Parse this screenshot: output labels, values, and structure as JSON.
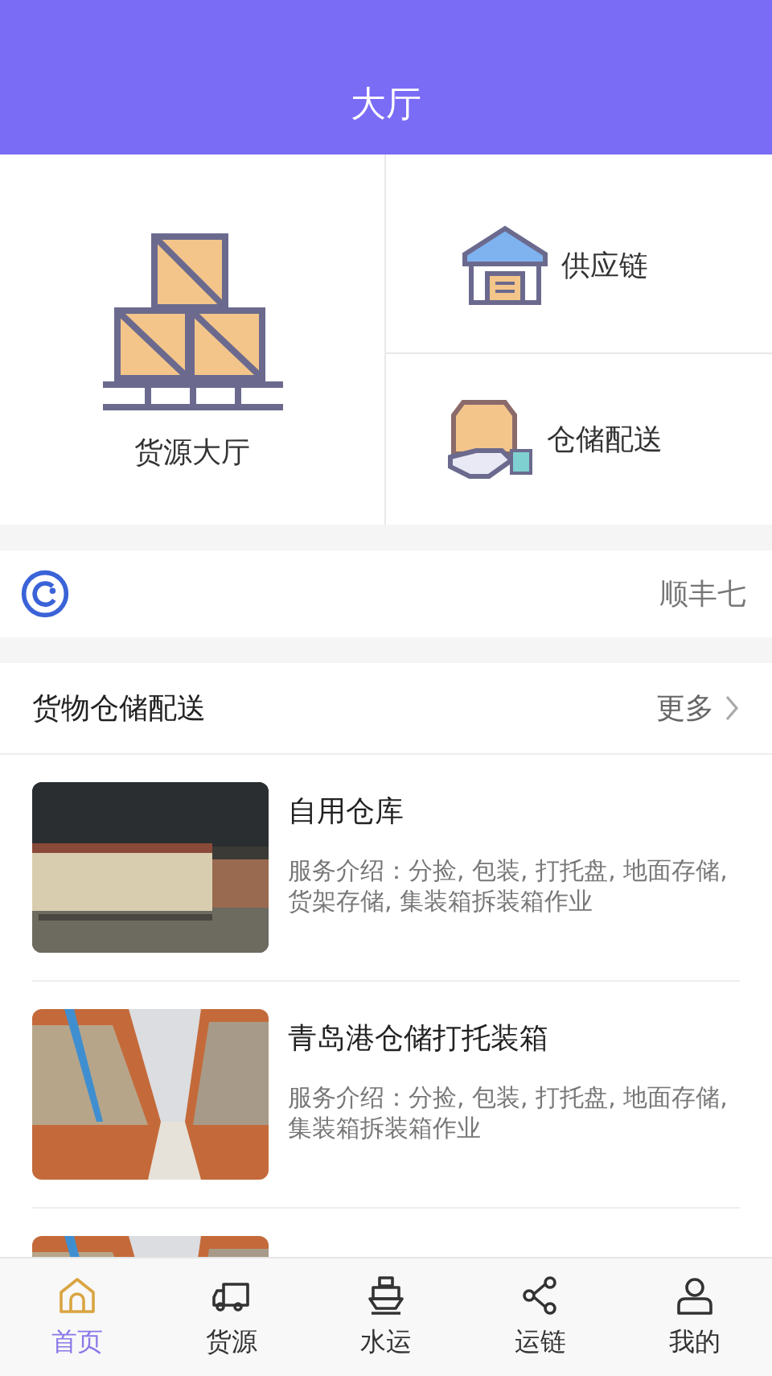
{
  "header": {
    "title": "大厅"
  },
  "main_entry": {
    "label": "货源大厅"
  },
  "side_entries": [
    {
      "label": "供应链",
      "kind": "warehouse"
    },
    {
      "label": "仓储配送",
      "kind": "delivery"
    }
  ],
  "notice": {
    "text": "顺丰七"
  },
  "section": {
    "title": "货物仓储配送",
    "more": "更多"
  },
  "items": [
    {
      "kind": "entry",
      "title": "自用仓库",
      "description": "服务介绍：分捡, 包装, 打托盘, 地面存储, 货架存储, 集装箱拆装箱作业"
    },
    {
      "kind": "entry",
      "title": "青岛港仓储打托装箱",
      "description": "服务介绍：分捡, 包装, 打托盘, 地面存储, 集装箱拆装箱作业"
    },
    {
      "kind": "picture"
    }
  ],
  "tabs": [
    {
      "label": "首页",
      "kind": "home",
      "selected": true
    },
    {
      "label": "货源",
      "kind": "truck",
      "selected": false
    },
    {
      "label": "水运",
      "kind": "ship",
      "selected": false
    },
    {
      "label": "运链",
      "kind": "share",
      "selected": false
    },
    {
      "label": "我的",
      "kind": "user",
      "selected": false
    }
  ]
}
